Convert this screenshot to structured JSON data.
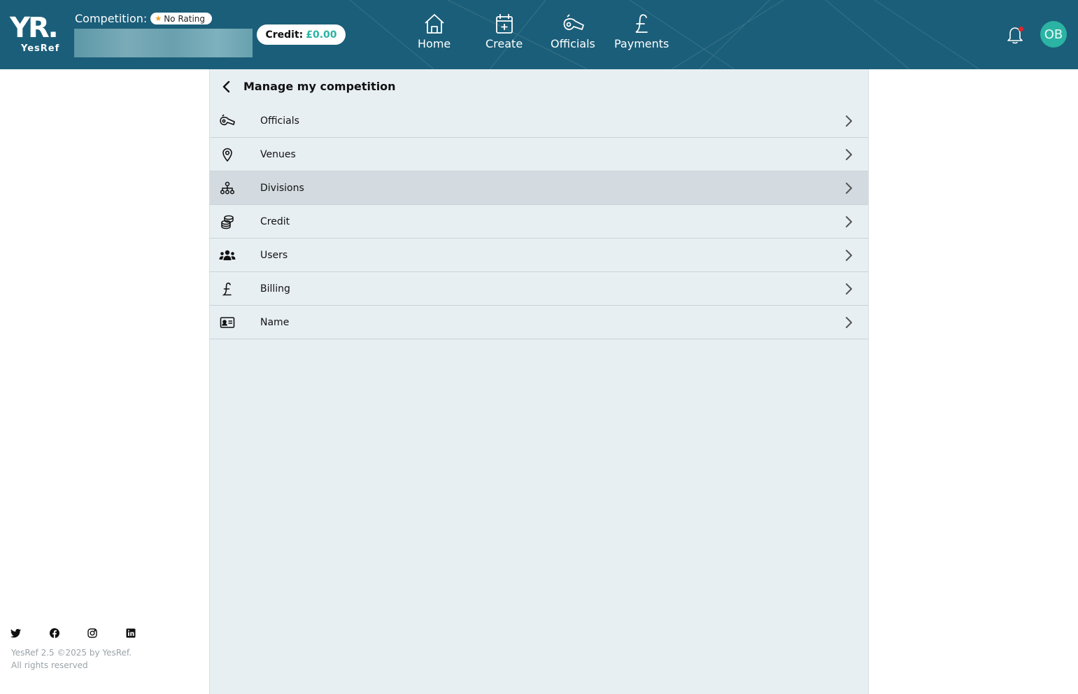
{
  "header": {
    "logo_mark": "YR.",
    "logo_text": "YesRef",
    "competition_label": "Competition:",
    "rating_badge": "No Rating",
    "credit_label": "Credit:",
    "credit_amount": "£0.00",
    "nav": [
      {
        "label": "Home",
        "icon": "home-icon"
      },
      {
        "label": "Create",
        "icon": "calendar-plus-icon"
      },
      {
        "label": "Officials",
        "icon": "whistle-icon"
      },
      {
        "label": "Payments",
        "icon": "pound-icon"
      }
    ],
    "avatar_initials": "OB",
    "notification_icon": "bell-icon"
  },
  "panel": {
    "title": "Manage my competition",
    "items": [
      {
        "label": "Officials",
        "icon": "whistle-icon",
        "active": false
      },
      {
        "label": "Venues",
        "icon": "map-pin-icon",
        "active": false
      },
      {
        "label": "Divisions",
        "icon": "hierarchy-icon",
        "active": true
      },
      {
        "label": "Credit",
        "icon": "coins-icon",
        "active": false
      },
      {
        "label": "Users",
        "icon": "users-icon",
        "active": false
      },
      {
        "label": "Billing",
        "icon": "pound-icon",
        "active": false
      },
      {
        "label": "Name",
        "icon": "id-card-icon",
        "active": false
      }
    ]
  },
  "footer": {
    "social": [
      "twitter-icon",
      "facebook-icon",
      "instagram-icon",
      "linkedin-icon"
    ],
    "line1": "YesRef 2.5 ©2025 by YesRef.",
    "line2": "All rights reserved"
  },
  "colors": {
    "header_bg": "#1b5e79",
    "accent": "#2bb3a3",
    "panel_bg": "#e8eff3",
    "active_row": "#d3dbe0",
    "notification_dot": "#e0242c"
  }
}
